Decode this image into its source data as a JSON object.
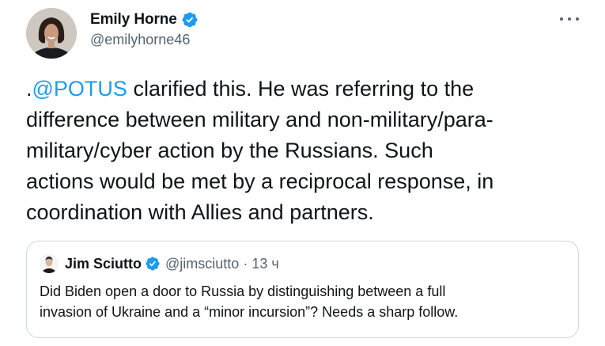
{
  "author": {
    "display_name": "Emily Horne",
    "handle": "@emilyhorne46",
    "verified": true
  },
  "tweet": {
    "prefix": ".",
    "mention": "@POTUS",
    "lines": [
      " clarified this. He was referring to the",
      "difference between military and non-military/para-",
      "military/cyber action by the Russians. Such",
      "actions would be met by a reciprocal response, in",
      "coordination with Allies and partners."
    ]
  },
  "quoted_tweet": {
    "display_name": "Jim Sciutto",
    "handle": "@jimsciutto",
    "separator": "·",
    "time": "13 ч",
    "verified": true,
    "text_lines": [
      "Did Biden open a door to Russia by distinguishing between a full",
      "invasion of Ukraine and a “minor incursion”? Needs a sharp follow."
    ]
  },
  "colors": {
    "link": "#1d9bf0",
    "verified_badge": "#1d9bf0",
    "secondary_text": "#536471",
    "border": "#cfd9de"
  },
  "icons": {
    "verified": "verified-badge-icon",
    "more": "more-horizontal-icon"
  }
}
